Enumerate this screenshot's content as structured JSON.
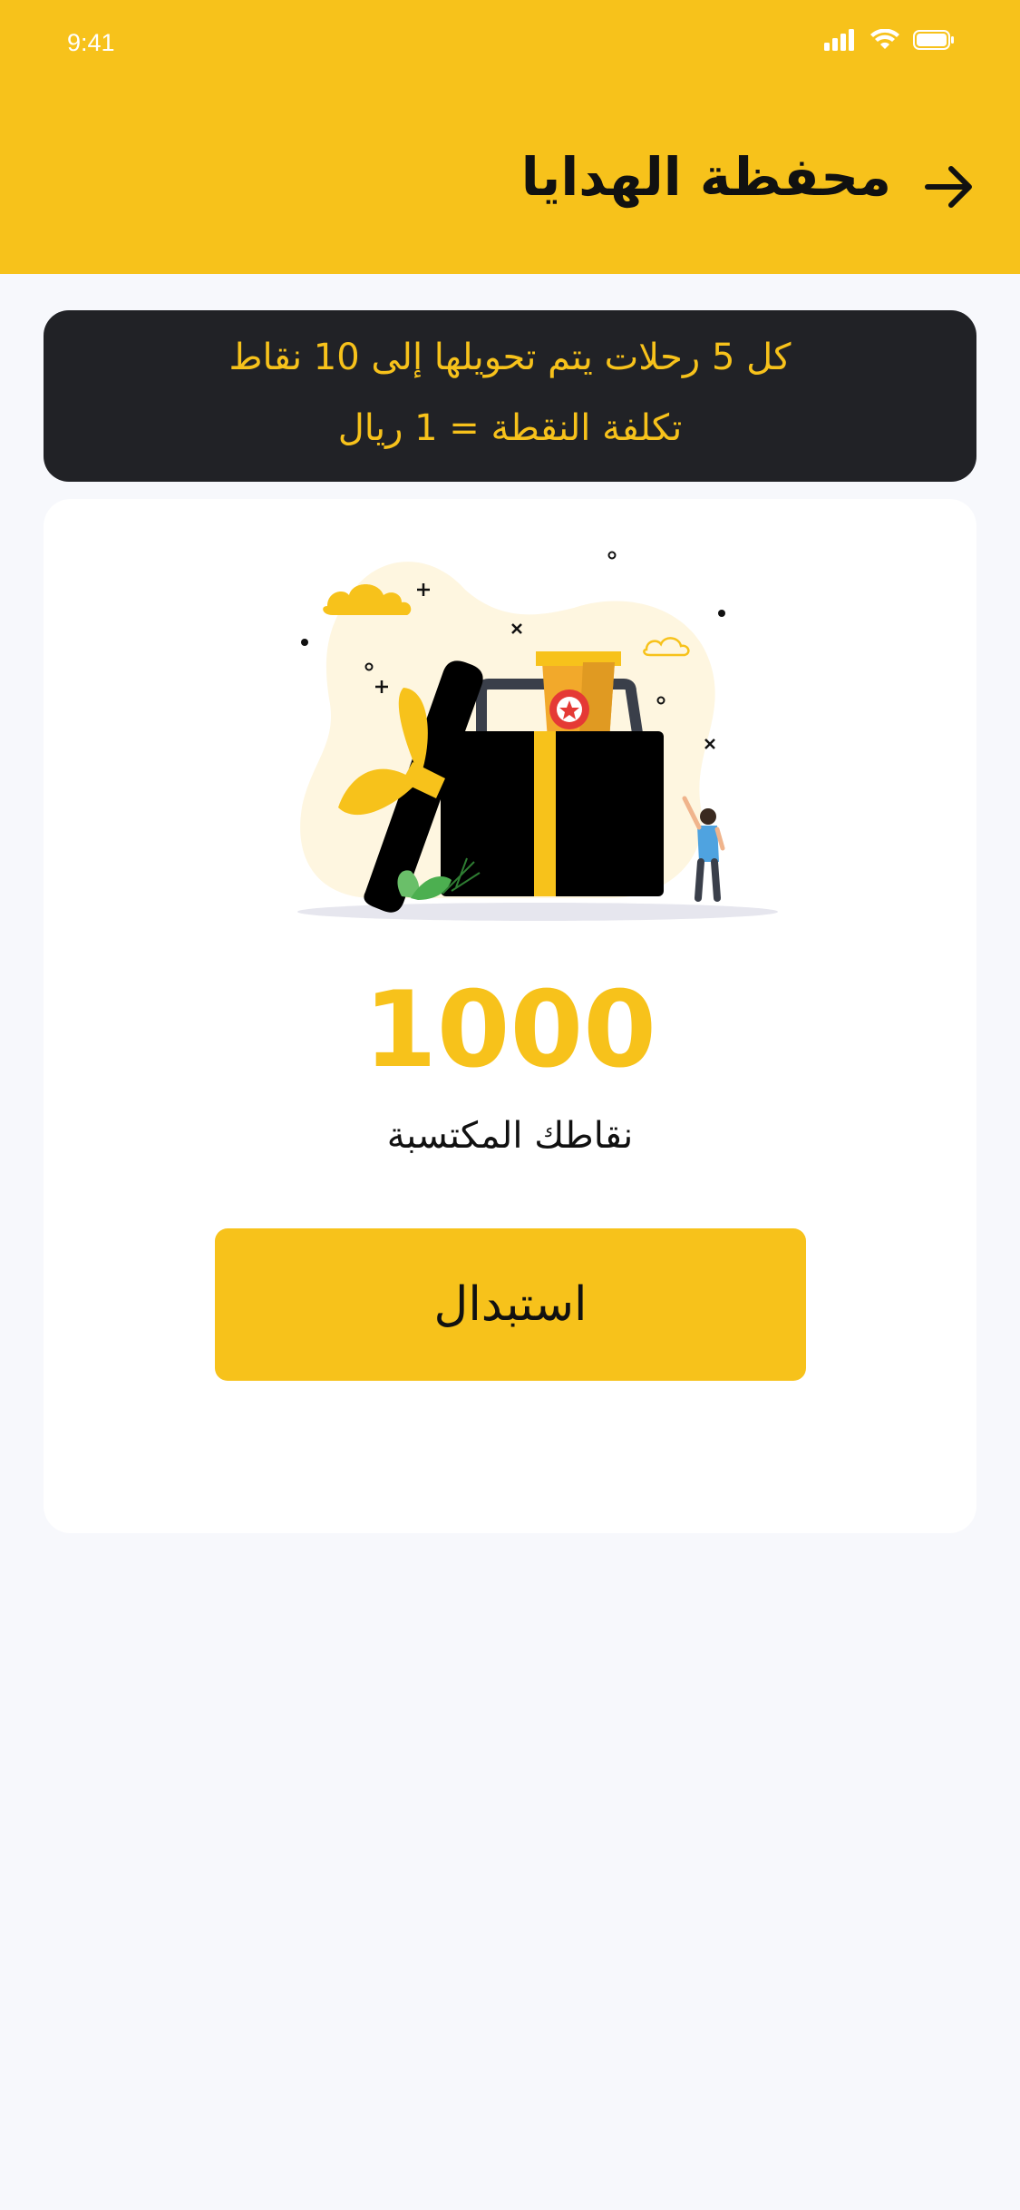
{
  "status_bar": {
    "time": "9:41"
  },
  "header": {
    "title": "محفظة الهدايا",
    "back_icon": "arrow-right-icon"
  },
  "info_banner": {
    "line1": "كل 5 رحلات يتم تحويلها إلى 10 نقاط",
    "line2": "تكلفة النقطة = 1 ريال"
  },
  "points": {
    "value": "1000",
    "label": "نقاطك المكتسبة"
  },
  "redeem_button": {
    "label": "استبدال"
  },
  "colors": {
    "accent": "#F7C21B",
    "banner_bg": "#212226",
    "page_bg": "#F7F8FC",
    "card_bg": "#FFFFFF"
  }
}
